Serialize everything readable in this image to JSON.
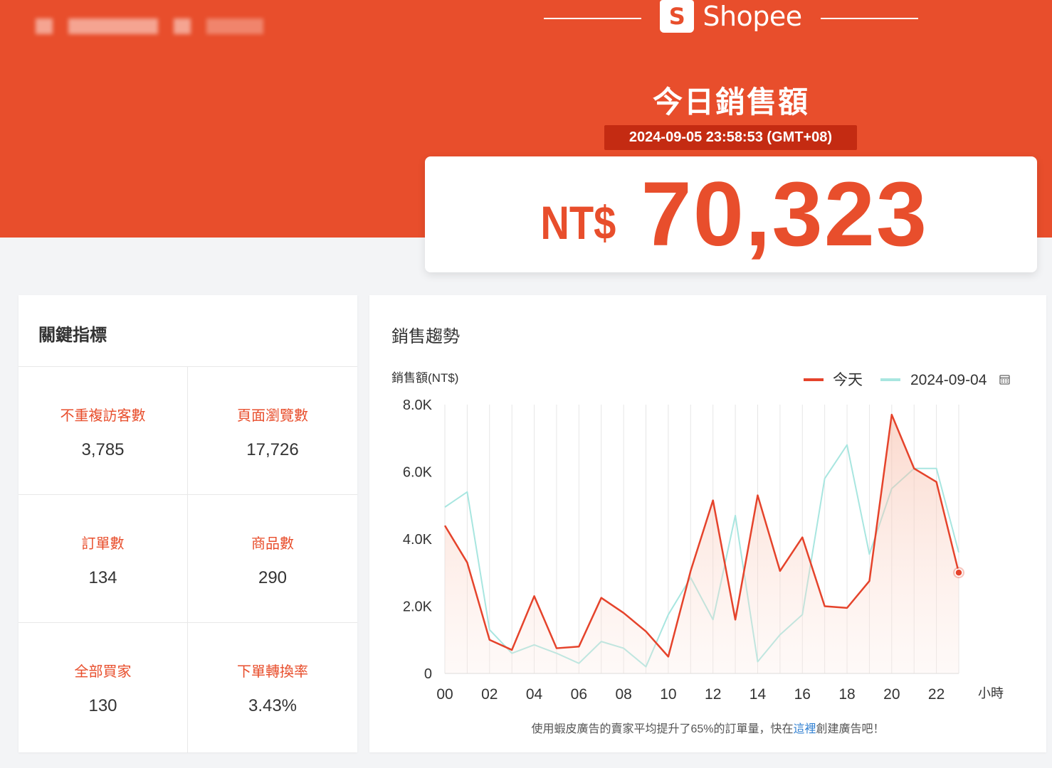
{
  "brand": {
    "name": "Shopee",
    "logo_letter": "S"
  },
  "hero": {
    "title": "今日銷售額",
    "timestamp": "2024-09-05 23:58:53 (GMT+08)",
    "currency": "NT$",
    "amount": "70,323"
  },
  "kpi_panel": {
    "title": "關鍵指標",
    "items": [
      {
        "label": "不重複訪客數",
        "value": "3,785"
      },
      {
        "label": "頁面瀏覽數",
        "value": "17,726"
      },
      {
        "label": "訂單數",
        "value": "134"
      },
      {
        "label": "商品數",
        "value": "290"
      },
      {
        "label": "全部買家",
        "value": "130"
      },
      {
        "label": "下單轉換率",
        "value": "3.43%"
      }
    ]
  },
  "trend_panel": {
    "title": "銷售趨勢",
    "footer_before": "使用蝦皮廣告的賣家平均提升了65%的訂單量，快在",
    "footer_link": "這裡",
    "footer_after": "創建廣告吧！"
  },
  "chart_data": {
    "type": "line",
    "ylabel": "銷售額(NT$)",
    "xlabel": "小時",
    "ylim": [
      0,
      8000
    ],
    "yticks": [
      0,
      2000,
      4000,
      6000,
      8000
    ],
    "ytick_labels": [
      "0",
      "2.0K",
      "4.0K",
      "6.0K",
      "8.0K"
    ],
    "x": [
      0,
      1,
      2,
      3,
      4,
      5,
      6,
      7,
      8,
      9,
      10,
      11,
      12,
      13,
      14,
      15,
      16,
      17,
      18,
      19,
      20,
      21,
      22,
      23
    ],
    "xtick_labels": [
      "00",
      "02",
      "04",
      "06",
      "08",
      "10",
      "12",
      "14",
      "16",
      "18",
      "20",
      "22"
    ],
    "legend_position": "top-right",
    "series": [
      {
        "name": "今天",
        "color": "#e5432b",
        "area": true,
        "values": [
          4400,
          3300,
          1000,
          700,
          2300,
          750,
          800,
          2250,
          1800,
          1250,
          500,
          3050,
          5150,
          1600,
          5300,
          3050,
          4050,
          2000,
          1950,
          2750,
          7700,
          6100,
          5700,
          3000
        ]
      },
      {
        "name": "2024-09-04",
        "color": "#a8e6e0",
        "area": false,
        "values": [
          4950,
          5400,
          1300,
          600,
          850,
          600,
          300,
          950,
          750,
          200,
          1750,
          2850,
          1600,
          4700,
          350,
          1150,
          1750,
          5800,
          6800,
          3550,
          5500,
          6100,
          6100,
          3600
        ]
      }
    ]
  }
}
